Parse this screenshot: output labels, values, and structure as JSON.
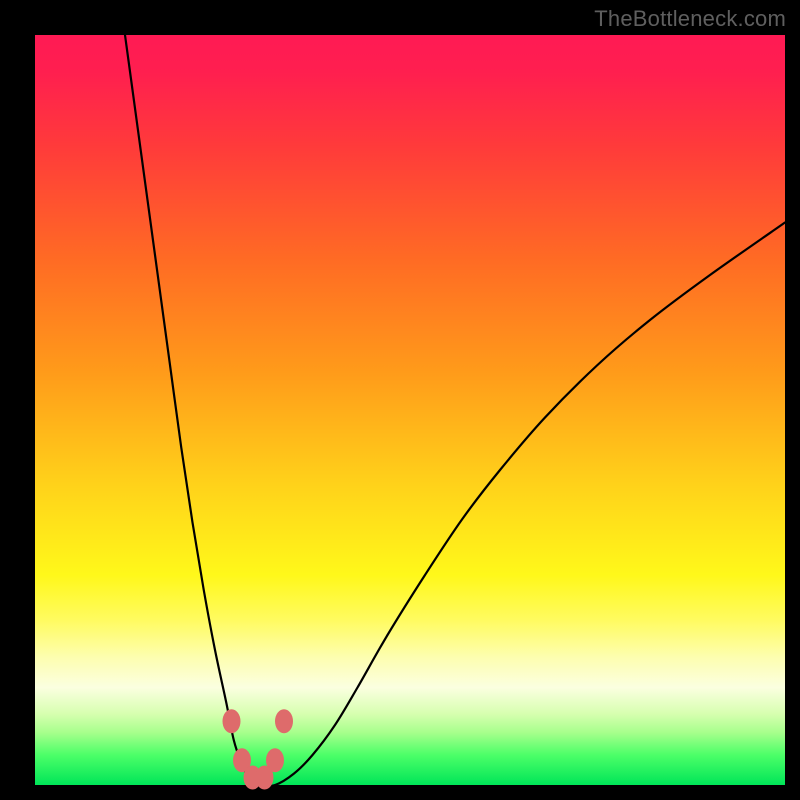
{
  "watermark": "TheBottleneck.com",
  "chart_data": {
    "type": "line",
    "title": "",
    "xlabel": "",
    "ylabel": "",
    "xlim": [
      0,
      100
    ],
    "ylim": [
      0,
      100
    ],
    "background_gradient": {
      "stops": [
        {
          "pos": 0.0,
          "color": "#ff1a54"
        },
        {
          "pos": 0.05,
          "color": "#ff1f4f"
        },
        {
          "pos": 0.15,
          "color": "#ff3b3a"
        },
        {
          "pos": 0.3,
          "color": "#ff6b24"
        },
        {
          "pos": 0.45,
          "color": "#ff9b1a"
        },
        {
          "pos": 0.6,
          "color": "#ffd21a"
        },
        {
          "pos": 0.72,
          "color": "#fff81a"
        },
        {
          "pos": 0.78,
          "color": "#fffb60"
        },
        {
          "pos": 0.83,
          "color": "#fdfeb0"
        },
        {
          "pos": 0.87,
          "color": "#fbffe0"
        },
        {
          "pos": 0.905,
          "color": "#d7ffb0"
        },
        {
          "pos": 0.93,
          "color": "#a7ff8c"
        },
        {
          "pos": 0.96,
          "color": "#4cff68"
        },
        {
          "pos": 1.0,
          "color": "#00e558"
        }
      ]
    },
    "series": [
      {
        "name": "bottleneck-curve",
        "color": "#000000",
        "x": [
          12.0,
          13.5,
          15.0,
          16.5,
          18.0,
          19.5,
          21.0,
          22.5,
          24.0,
          25.5,
          26.5,
          27.5,
          28.5,
          30.0,
          32.0,
          34.5,
          37.0,
          40.0,
          43.0,
          47.0,
          52.0,
          57.0,
          62.0,
          68.0,
          75.0,
          82.0,
          90.0,
          100.0
        ],
        "y": [
          100.0,
          89.0,
          78.0,
          67.0,
          56.0,
          45.0,
          35.0,
          26.0,
          18.0,
          11.0,
          6.0,
          3.0,
          1.0,
          0.0,
          0.0,
          1.5,
          4.0,
          8.0,
          13.0,
          20.0,
          28.0,
          35.5,
          42.0,
          49.0,
          56.0,
          62.0,
          68.0,
          75.0
        ]
      }
    ],
    "markers": [
      {
        "x": 26.2,
        "y": 8.5,
        "color": "#de6b6b"
      },
      {
        "x": 33.2,
        "y": 8.5,
        "color": "#de6b6b"
      },
      {
        "x": 27.6,
        "y": 3.3,
        "color": "#de6b6b"
      },
      {
        "x": 32.0,
        "y": 3.3,
        "color": "#de6b6b"
      },
      {
        "x": 29.0,
        "y": 1.0,
        "color": "#de6b6b"
      },
      {
        "x": 30.6,
        "y": 1.0,
        "color": "#de6b6b"
      }
    ]
  }
}
